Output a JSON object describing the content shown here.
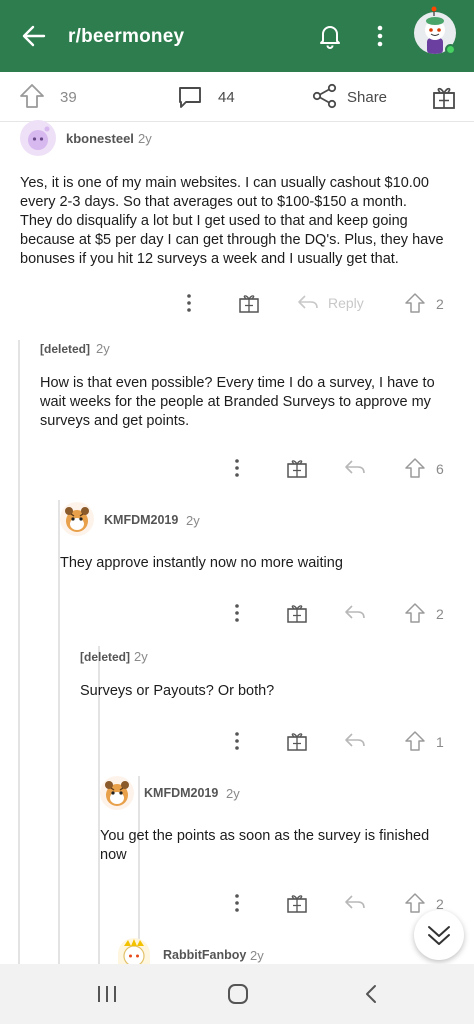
{
  "header": {
    "title": "r/beermoney",
    "bg_color": "#2e7d4f"
  },
  "postbar": {
    "upvotes": "39",
    "comments": "44",
    "share_label": "Share"
  },
  "comments": [
    {
      "author": "kbonesteel",
      "age": "2y",
      "body_lines": [
        "Yes, it is one of my main websites. I can usually cashout $10.00",
        "every 2-3 days. So that averages out to $100-$150 a month.",
        "They do disqualify a lot but I get used to that and keep going",
        "because at $5 per day I can get through the DQ's. Plus, they have",
        "bonuses if you hit 12 surveys a week and I usually get that."
      ],
      "reply_label": "Reply",
      "score": "2"
    },
    {
      "author": "[deleted]",
      "age": "2y",
      "body_lines": [
        "How is that even possible? Every time I do a survey, I have to",
        "wait weeks for the people at Branded Surveys to approve my",
        "surveys and get points."
      ],
      "score": "6"
    },
    {
      "author": "KMFDM2019",
      "age": "2y",
      "body_lines": [
        "They approve instantly now no more waiting"
      ],
      "score": "2"
    },
    {
      "author": "[deleted]",
      "age": "2y",
      "body_lines": [
        "Surveys or Payouts? Or both?"
      ],
      "score": "1"
    },
    {
      "author": "KMFDM2019",
      "age": "2y",
      "body_lines": [
        "You get the points as soon as the survey is finished",
        "now"
      ],
      "score": "2"
    },
    {
      "author": "RabbitFanboy",
      "age": "2y"
    }
  ],
  "icons": [
    "back-arrow-icon",
    "bell-icon",
    "kebab-icon",
    "upvote-icon",
    "comment-icon",
    "share-icon",
    "gift-icon",
    "reply-icon",
    "chevron-down-icon",
    "recent-apps-icon",
    "home-icon",
    "nav-back-icon"
  ]
}
